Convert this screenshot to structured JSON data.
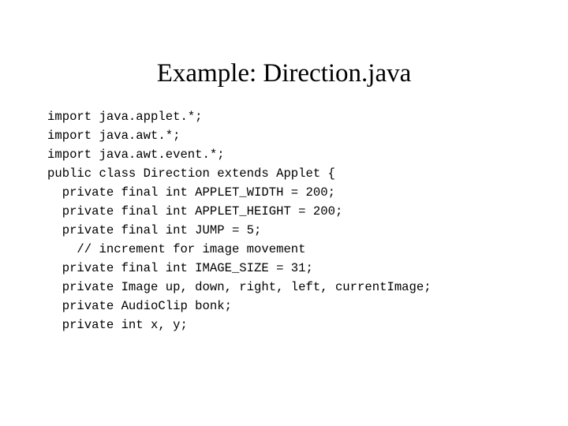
{
  "slide": {
    "title": "Example: Direction.java",
    "background_color": "#ffffff",
    "text_color": "#000000",
    "code": {
      "language": "java",
      "lines": [
        "import java.applet.*;",
        "import java.awt.*;",
        "import java.awt.event.*;",
        "public class Direction extends Applet {",
        "  private final int APPLET_WIDTH = 200;",
        "  private final int APPLET_HEIGHT = 200;",
        "  private final int JUMP = 5;",
        "    // increment for image movement",
        "  private final int IMAGE_SIZE = 31;",
        "  private Image up, down, right, left, currentImage;",
        "  private AudioClip bonk;",
        "  private int x, y;"
      ]
    }
  }
}
